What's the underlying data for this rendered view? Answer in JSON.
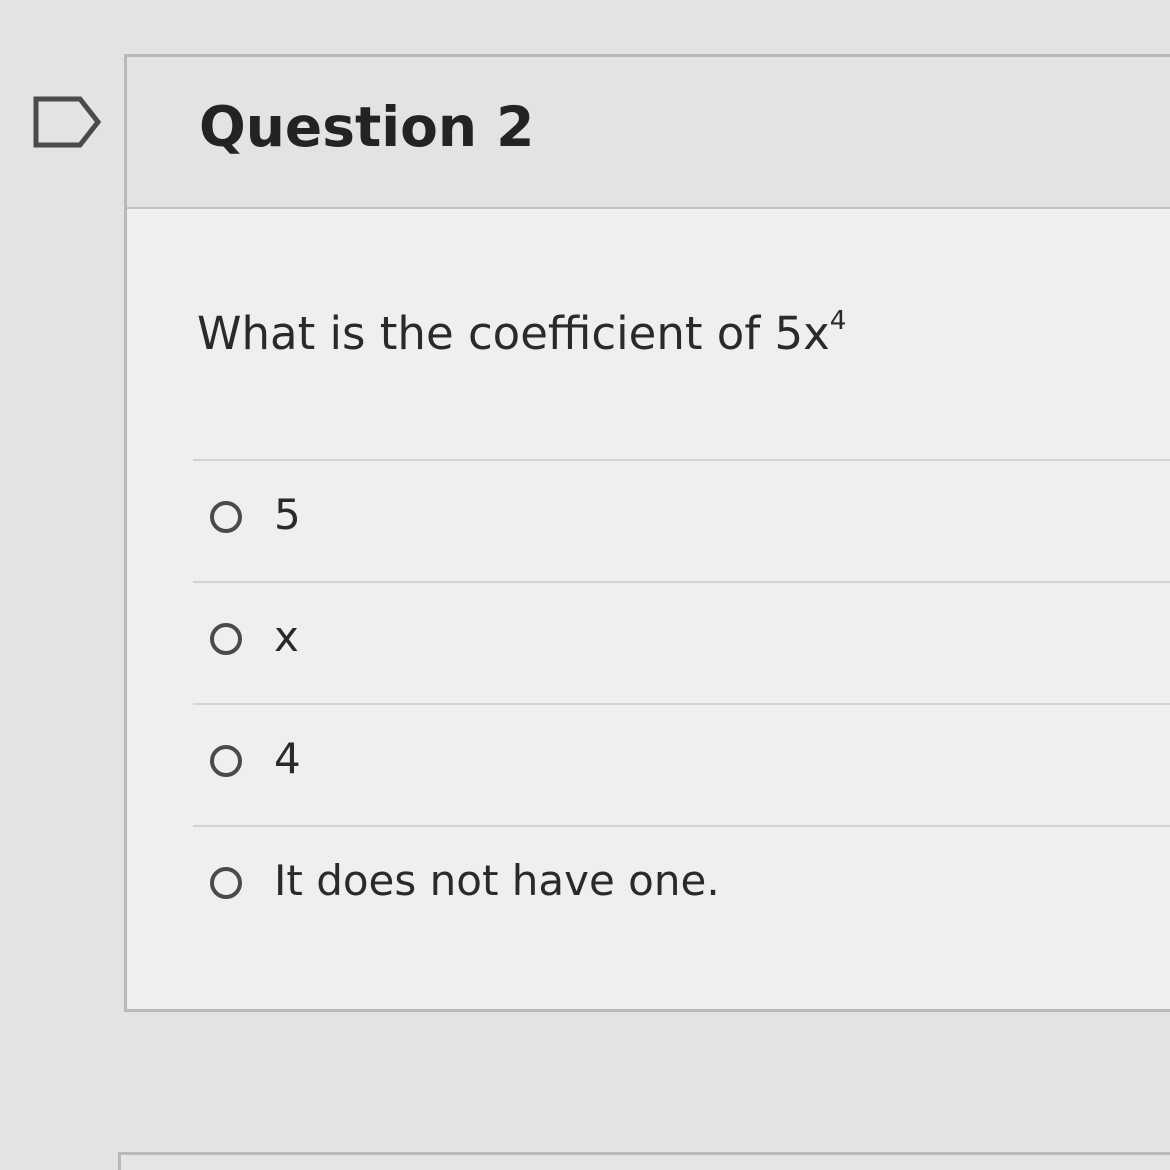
{
  "flag_icon": "flag-outline-icon",
  "question": {
    "title": "Question 2",
    "text": "What is the coefficient of 5x",
    "text_superscript": "4"
  },
  "answers": [
    {
      "label": "5",
      "icon": "radio-unchecked-icon"
    },
    {
      "label": "x",
      "icon": "radio-unchecked-icon"
    },
    {
      "label": "4",
      "icon": "radio-unchecked-icon"
    },
    {
      "label": "It does not have one.",
      "icon": "radio-unchecked-icon"
    }
  ],
  "colors": {
    "page_background": "#e4e3e1",
    "card_background": "#efefee",
    "header_background": "#e3e3e1",
    "border": "#b9b9b7",
    "text": "#2a2a2a"
  }
}
